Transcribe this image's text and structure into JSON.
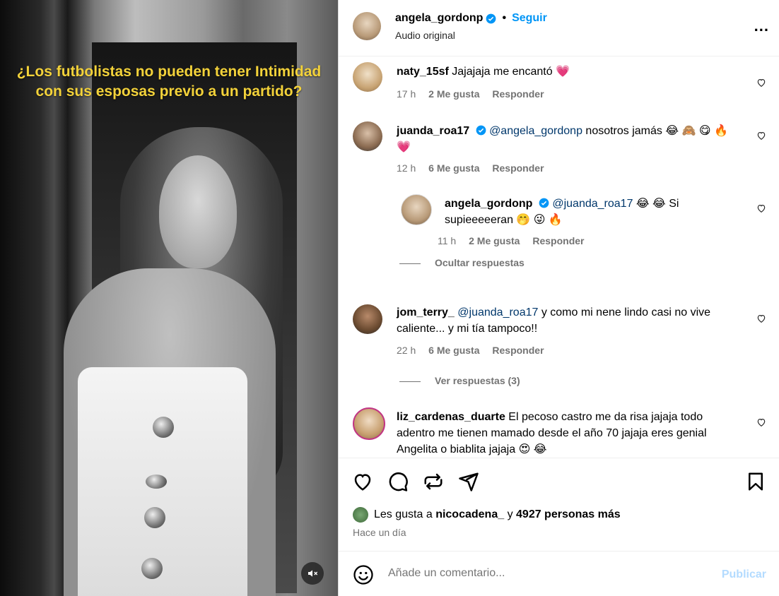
{
  "media": {
    "overlay_text": "¿Los futbolistas no pueden tener Intimidad con sus esposas previo a un partido?",
    "mute_icon": "speaker-muted-icon"
  },
  "header": {
    "username": "angela_gordonp",
    "dot": "•",
    "follow": "Seguir",
    "subtitle": "Audio original",
    "more": "..."
  },
  "comments": [
    {
      "user": "naty_15sf",
      "text": "Jajajaja me encantó 💗",
      "time": "17 h",
      "likes": "2 Me gusta",
      "reply": "Responder"
    },
    {
      "user": "juanda_roa17",
      "mention": "@angela_gordonp",
      "text": " nosotros jamás 😂 🙈 😋 🔥 💗",
      "time": "12 h",
      "likes": "6 Me gusta",
      "reply": "Responder"
    },
    {
      "user": "angela_gordonp",
      "mention": "@juanda_roa17",
      "text": " 😂 😂 Si supieeeeeran 🤭 😜 🔥",
      "time": "11 h",
      "likes": "2 Me gusta",
      "reply": "Responder"
    },
    {
      "user": "jom_terry_",
      "mention": "@juanda_roa17",
      "text": " y como mi nene lindo casi no vive caliente... y mi tía tampoco!!",
      "time": "22 h",
      "likes": "6 Me gusta",
      "reply": "Responder"
    },
    {
      "user": "liz_cardenas_duarte",
      "text": " El pecoso castro me da risa jajaja todo adentro me tienen mamado desde el año 70 jajaja eres genial Angelita o biablita jajaja 😍 😂"
    }
  ],
  "toggles": {
    "hide_replies": "Ocultar respuestas",
    "view_replies": "Ver respuestas (3)"
  },
  "likes": {
    "prefix": "Les gusta a ",
    "user": "nicocadena_",
    "middle": " y ",
    "others": "4927 personas más"
  },
  "ago": "Hace un día",
  "add_comment": {
    "placeholder": "Añade un comentario...",
    "publish": "Publicar"
  },
  "colors": {
    "link": "#0095f6",
    "mention": "#00376b",
    "muted": "#737373",
    "publish_disabled": "#b3dbff",
    "overlay_text": "#f3d23a"
  }
}
